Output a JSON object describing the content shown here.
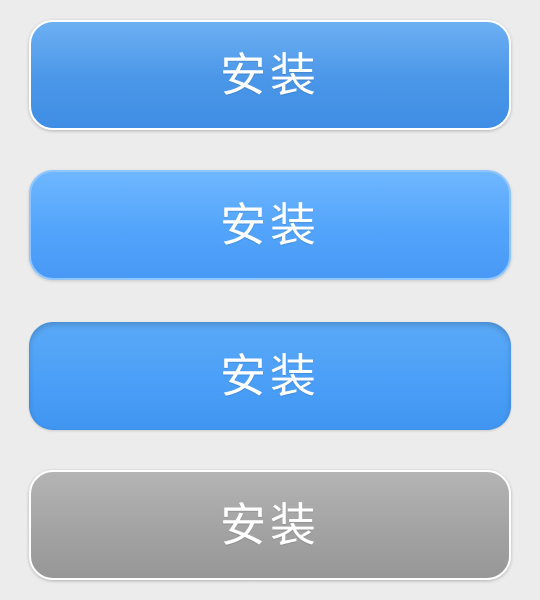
{
  "buttons": [
    {
      "state": "normal",
      "label": "安装"
    },
    {
      "state": "hover",
      "label": "安装"
    },
    {
      "state": "pressed",
      "label": "安装"
    },
    {
      "state": "disabled",
      "label": "安装"
    }
  ],
  "colors": {
    "background": "#ececec",
    "primary": "#4a96e8",
    "hover": "#52a4fb",
    "pressed": "#4b9ff7",
    "disabled": "#a3a3a3",
    "label": "#ffffff"
  }
}
